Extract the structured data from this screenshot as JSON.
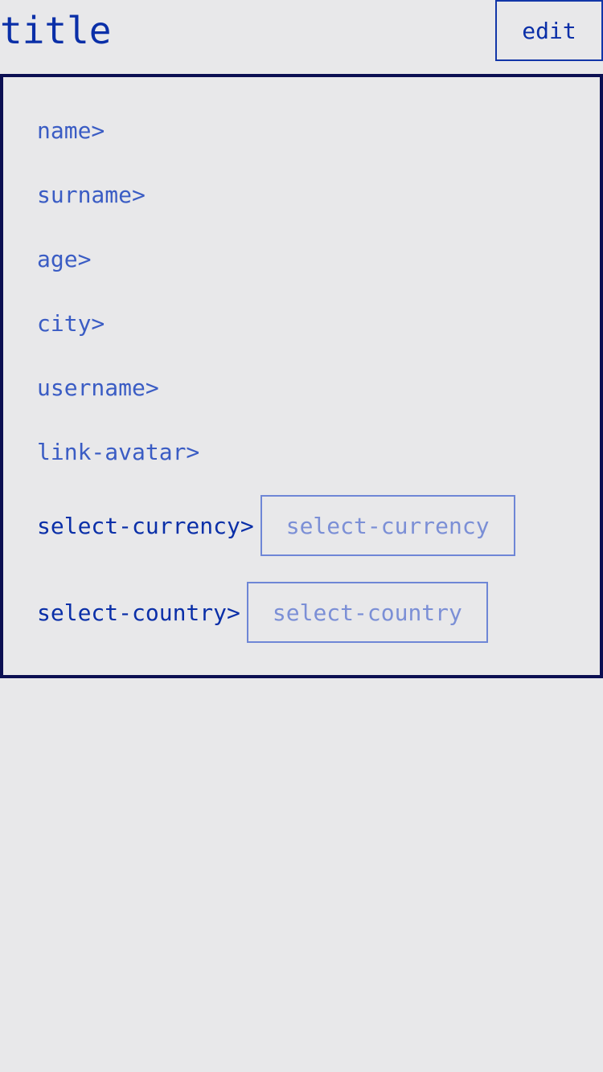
{
  "header": {
    "title": "title",
    "edit_label": "edit"
  },
  "fields": {
    "name": "name>",
    "surname": "surname>",
    "age": "age>",
    "city": "city>",
    "username": "username>",
    "link_avatar": "link-avatar>"
  },
  "selects": {
    "currency": {
      "label": "select-currency>",
      "value": "select-currency"
    },
    "country": {
      "label": "select-country>",
      "value": "select-country"
    }
  },
  "colors": {
    "background": "#e8e8ea",
    "primary": "#0a2fa8",
    "link": "#3a5cc4",
    "placeholder": "#7b8fd6",
    "panel_border": "#0b0f52"
  }
}
